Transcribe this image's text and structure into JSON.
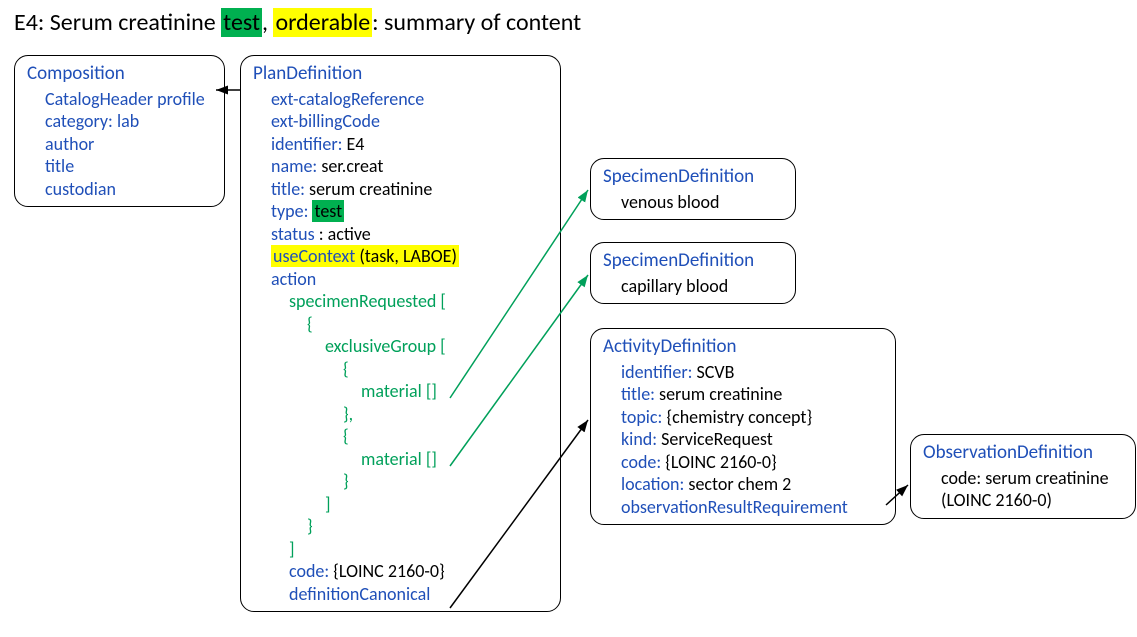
{
  "title": {
    "prefix": "E4: Serum creatinine ",
    "hl1": "test",
    "mid": ", ",
    "hl2": "orderable",
    "suffix": ": summary of content"
  },
  "composition": {
    "head": "Composition",
    "l1": "CatalogHeader profile",
    "l2": "category: lab",
    "l3": "author",
    "l4": "title",
    "l5": "custodian"
  },
  "plan": {
    "head": "PlanDefinition",
    "l1": "ext-catalogReference",
    "l2": "ext-billingCode",
    "l3a": "identifier: ",
    "l3b": "E4",
    "l4a": "name: ",
    "l4b": "ser.creat",
    "l5a": "title: ",
    "l5b": "serum creatinine",
    "l6a": "type: ",
    "l6hl": "test",
    "l7a": "status",
    "l7b": " : active",
    "l8a": "useContext ",
    "l8b": "(task, LABOE)",
    "l9": "action",
    "sr": "specimenRequested [",
    "ob": "{",
    "eg": "exclusiveGroup [",
    "mat": "material  []",
    "cbc": "},",
    "cb": "}",
    "cbr": "]",
    "codea": "code: ",
    "codeb": "{LOINC 2160-0}",
    "defc": "definitionCanonical"
  },
  "spec1": {
    "head": "SpecimenDefinition",
    "body": "venous blood"
  },
  "spec2": {
    "head": "SpecimenDefinition",
    "body": "capillary blood"
  },
  "act": {
    "head": "ActivityDefinition",
    "l1a": "identifier: ",
    "l1b": "SCVB",
    "l2a": "title: ",
    "l2b": "serum creatinine",
    "l3a": "topic: ",
    "l3b": "{chemistry concept}",
    "l4a": "kind: ",
    "l4b": "ServiceRequest",
    "l5a": "code: ",
    "l5b": "{LOINC 2160-0}",
    "l6a": "location: ",
    "l6b": "sector chem 2",
    "l7": "observationResultRequirement"
  },
  "obs": {
    "head": "ObservationDefinition",
    "l1": "code: serum creatinine",
    "l2": "(LOINC 2160-0)"
  }
}
